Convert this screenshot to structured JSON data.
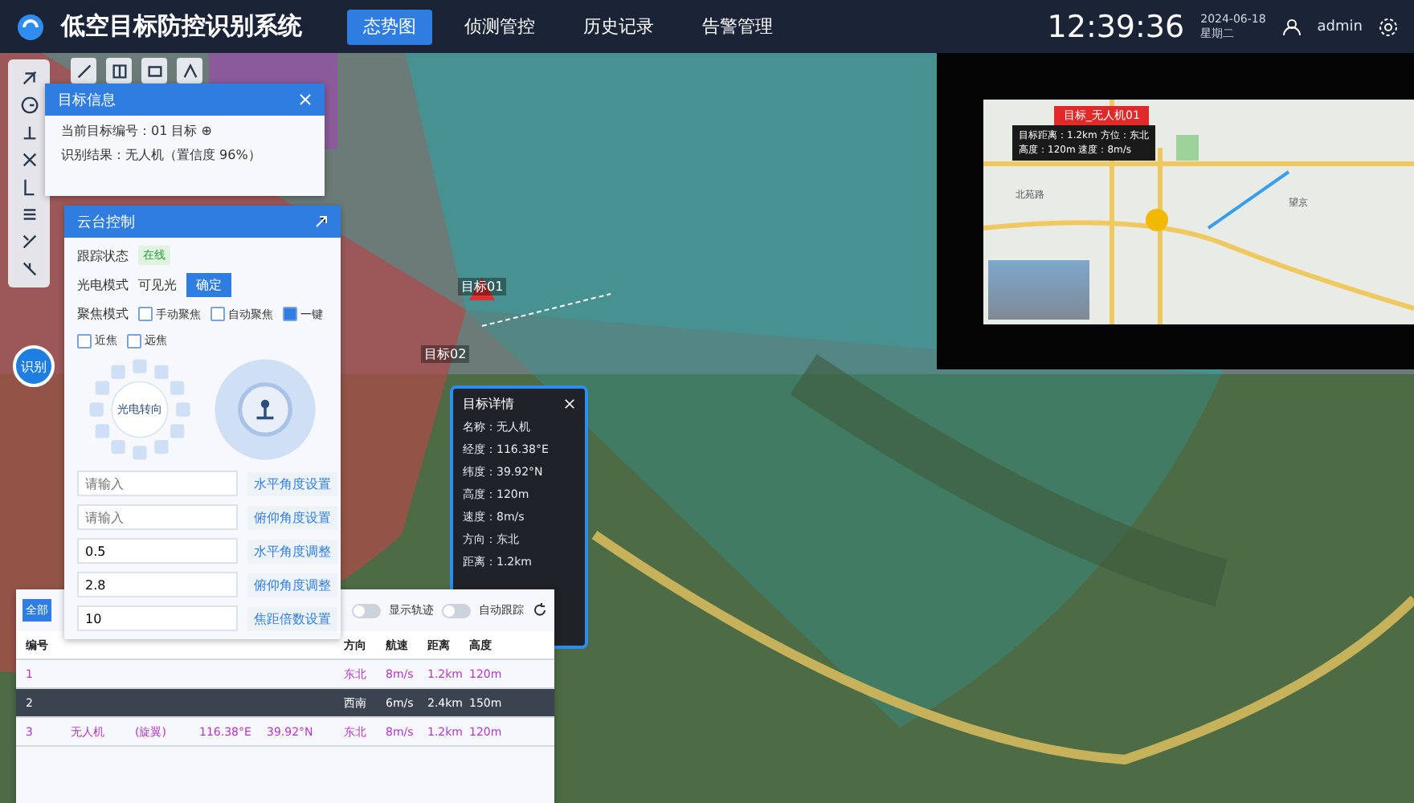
{
  "header": {
    "title": "低空目标防控识别系统",
    "nav": [
      {
        "label": "态势图",
        "selected": true
      },
      {
        "label": "侦测管控",
        "selected": false
      },
      {
        "label": "历史记录",
        "selected": false
      },
      {
        "label": "告警管理",
        "selected": false
      }
    ],
    "time": "12:39:36",
    "date": "2024-06-18",
    "weekday": "星期二",
    "user": "admin"
  },
  "map": {
    "labels": [
      "目标01",
      "目标02"
    ]
  },
  "round_button": "识别",
  "target_panel": {
    "title": "目标信息",
    "lines": [
      "当前目标编号：01 目标 ⊕",
      "识别结果：无人机（置信度 96%）"
    ]
  },
  "control_panel": {
    "title": "云台控制",
    "status_label": "跟踪状态",
    "status": "在线",
    "mode_label": "光电模式",
    "mode_value": "可见光",
    "confirm": "确定",
    "focus_label": "聚焦模式",
    "focus_options": [
      {
        "label": "手动聚焦",
        "checked": false
      },
      {
        "label": "自动聚焦",
        "checked": false
      },
      {
        "label": "一键",
        "checked": true
      },
      {
        "label": "近焦",
        "checked": false
      },
      {
        "label": "远焦",
        "checked": false
      }
    ],
    "dial_label": "光电转向",
    "fields": [
      {
        "placeholder": "请输入",
        "action": "水平角度设置"
      },
      {
        "placeholder": "请输入",
        "action": "俯仰角度设置"
      },
      {
        "value": "0.5",
        "action": "水平角度调整"
      },
      {
        "value": "2.8",
        "action": "俯仰角度调整"
      },
      {
        "value": "10",
        "action": "焦距倍数设置"
      }
    ]
  },
  "table_panel": {
    "tab": {
      "label": "全部",
      "selected": true
    },
    "toggles": [
      {
        "label": "显示轨迹",
        "on": false
      },
      {
        "label": "自动跟踪",
        "on": false
      }
    ],
    "header": {
      "lead": "编号",
      "cells": [
        "方向",
        "航速",
        "距离",
        "高度"
      ]
    },
    "rows": [
      {
        "lead": "1",
        "cells": [
          "东北",
          "8m/s",
          "1.2km",
          "120m"
        ],
        "selected": false
      },
      {
        "lead": "2",
        "cells": [
          "西南",
          "6m/s",
          "2.4km",
          "150m"
        ],
        "selected": true
      },
      {
        "lead": "3",
        "middle": [
          "无人机",
          "(旋翼)",
          "116.38°E",
          "39.92°N"
        ],
        "cells": [
          "东北",
          "8m/s",
          "1.2km",
          "120m"
        ],
        "selected": false
      }
    ]
  },
  "info_popup": {
    "title": "目标详情",
    "lines": [
      "名称：无人机",
      "经度：116.38°E",
      "纬度：39.92°N",
      "高度：120m",
      "速度：8m/s",
      "方向：东北",
      "距离：1.2km"
    ]
  },
  "video_panel": {
    "tag": "目标_无人机01",
    "caption": [
      "目标距离：1.2km 方位：东北",
      "高度：120m 速度：8m/s"
    ],
    "place_labels": [
      "北苑路",
      "望京"
    ]
  }
}
